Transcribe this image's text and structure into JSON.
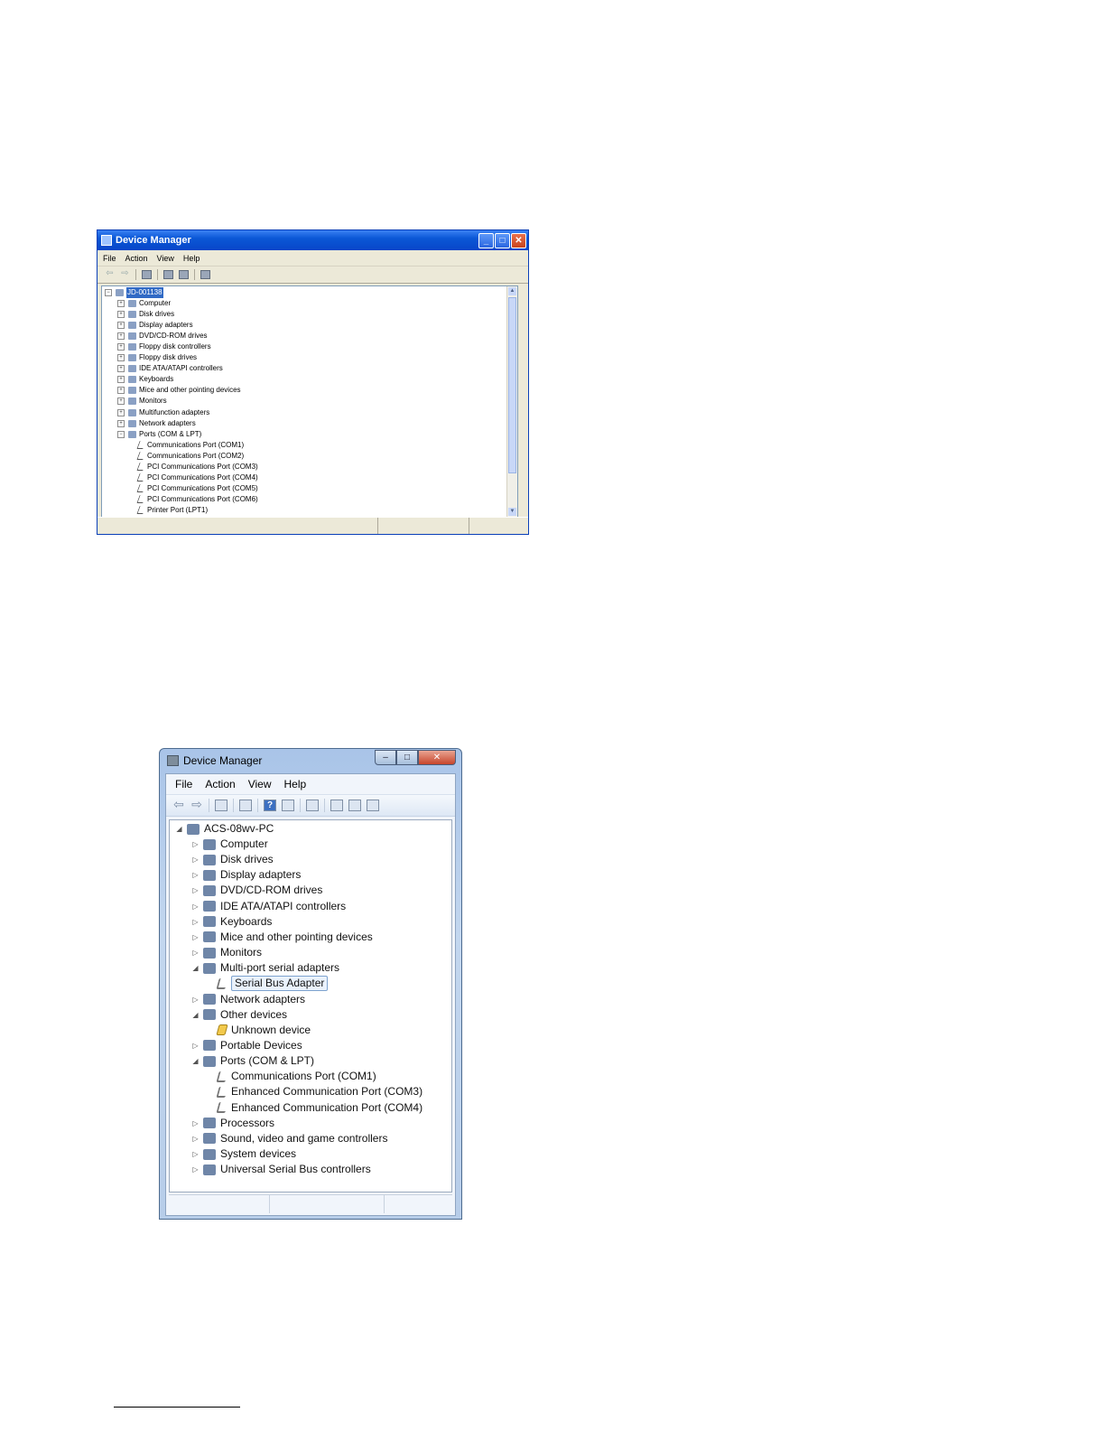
{
  "xp_window": {
    "title": "Device Manager",
    "title_buttons": {
      "minimize": "_",
      "maximize": "□",
      "close": "✕"
    },
    "menu": [
      "File",
      "Action",
      "View",
      "Help"
    ],
    "root": "JD-001138",
    "items": [
      {
        "label": "Computer",
        "expanded": false
      },
      {
        "label": "Disk drives",
        "expanded": false
      },
      {
        "label": "Display adapters",
        "expanded": false
      },
      {
        "label": "DVD/CD-ROM drives",
        "expanded": false
      },
      {
        "label": "Floppy disk controllers",
        "expanded": false
      },
      {
        "label": "Floppy disk drives",
        "expanded": false
      },
      {
        "label": "IDE ATA/ATAPI controllers",
        "expanded": false
      },
      {
        "label": "Keyboards",
        "expanded": false
      },
      {
        "label": "Mice and other pointing devices",
        "expanded": false
      },
      {
        "label": "Monitors",
        "expanded": false
      },
      {
        "label": "Multifunction adapters",
        "expanded": false
      },
      {
        "label": "Network adapters",
        "expanded": false
      },
      {
        "label": "Ports (COM & LPT)",
        "expanded": true
      },
      {
        "label": "Communications Port (COM1)",
        "child": true
      },
      {
        "label": "Communications Port (COM2)",
        "child": true
      },
      {
        "label": "PCI Communications Port (COM3)",
        "child": true
      },
      {
        "label": "PCI Communications Port (COM4)",
        "child": true
      },
      {
        "label": "PCI Communications Port (COM5)",
        "child": true
      },
      {
        "label": "PCI Communications Port (COM6)",
        "child": true
      },
      {
        "label": "Printer Port (LPT1)",
        "child": true
      }
    ]
  },
  "win7_window": {
    "title": "Device Manager",
    "title_buttons": {
      "minimize": "–",
      "maximize": "□",
      "close": "✕"
    },
    "menu": [
      "File",
      "Action",
      "View",
      "Help"
    ],
    "root": "ACS-08wv-PC",
    "items": [
      {
        "label": "Computer",
        "expanded": false
      },
      {
        "label": "Disk drives",
        "expanded": false
      },
      {
        "label": "Display adapters",
        "expanded": false
      },
      {
        "label": "DVD/CD-ROM drives",
        "expanded": false
      },
      {
        "label": "IDE ATA/ATAPI controllers",
        "expanded": false
      },
      {
        "label": "Keyboards",
        "expanded": false
      },
      {
        "label": "Mice and other pointing devices",
        "expanded": false
      },
      {
        "label": "Monitors",
        "expanded": false
      },
      {
        "label": "Multi-port serial adapters",
        "expanded": true
      },
      {
        "label": "Serial Bus Adapter",
        "child": true,
        "selected": true
      },
      {
        "label": "Network adapters",
        "expanded": false
      },
      {
        "label": "Other devices",
        "expanded": true
      },
      {
        "label": "Unknown device",
        "child": true,
        "warning": true
      },
      {
        "label": "Portable Devices",
        "expanded": false
      },
      {
        "label": "Ports (COM & LPT)",
        "expanded": true
      },
      {
        "label": "Communications Port (COM1)",
        "child": true
      },
      {
        "label": "Enhanced Communication Port (COM3)",
        "child": true
      },
      {
        "label": "Enhanced Communication Port (COM4)",
        "child": true
      },
      {
        "label": "Processors",
        "expanded": false
      },
      {
        "label": "Sound, video and game controllers",
        "expanded": false
      },
      {
        "label": "System devices",
        "expanded": false
      },
      {
        "label": "Universal Serial Bus controllers",
        "expanded": false
      }
    ]
  }
}
